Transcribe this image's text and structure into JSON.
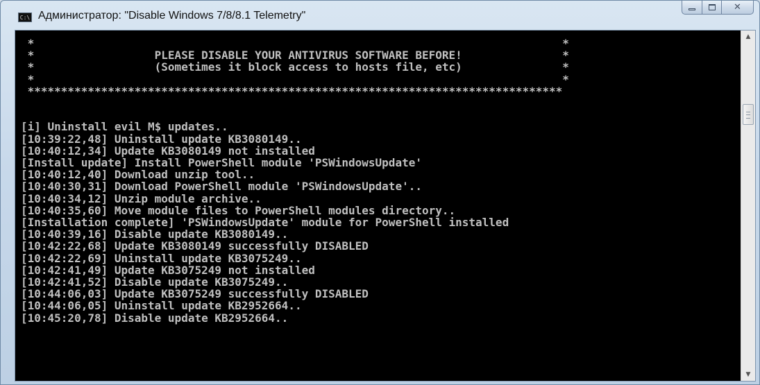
{
  "window": {
    "title": "Администратор:  \"Disable Windows 7/8/8.1 Telemetry\"",
    "icon_label": "C:\\",
    "controls": {
      "minimize": "minimize-icon",
      "maximize": "maximize-icon",
      "close": "✕"
    }
  },
  "console": {
    "lines": [
      " *                                                                               *",
      " *                  PLEASE DISABLE YOUR ANTIVIRUS SOFTWARE BEFORE!               *",
      " *                  (Sometimes it block access to hosts file, etc)               *",
      " *                                                                               *",
      " ********************************************************************************",
      "",
      "",
      "[i] Uninstall evil M$ updates..",
      "[10:39:22,48] Uninstall update KB3080149..",
      "[10:40:12,34] Update KB3080149 not installed",
      "[Install update] Install PowerShell module 'PSWindowsUpdate'",
      "[10:40:12,40] Download unzip tool..",
      "[10:40:30,31] Download PowerShell module 'PSWindowsUpdate'..",
      "[10:40:34,12] Unzip module archive..",
      "[10:40:35,60] Move module files to PowerShell modules directory..",
      "[Installation complete] 'PSWindowsUpdate' module for PowerShell installed",
      "[10:40:39,16] Disable update KB3080149..",
      "[10:42:22,68] Update KB3080149 successfully DISABLED",
      "[10:42:22,69] Uninstall update KB3075249..",
      "[10:42:41,49] Update KB3075249 not installed",
      "[10:42:41,52] Disable update KB3075249..",
      "[10:44:06,03] Update KB3075249 successfully DISABLED",
      "[10:44:06,05] Uninstall update KB2952664..",
      "[10:45:20,78] Disable update KB2952664.."
    ]
  },
  "scrollbar": {
    "up_icon": "▲",
    "down_icon": "▼"
  },
  "colors": {
    "console_background": "#000000",
    "console_text": "#c0c0c0",
    "titlebar": "#c7d8ea"
  }
}
